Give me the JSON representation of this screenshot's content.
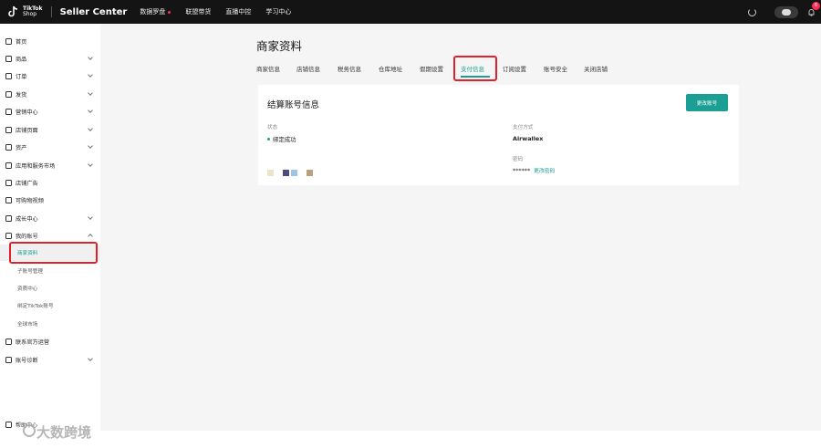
{
  "topbar": {
    "logo_line1": "TikTok",
    "logo_line2": "Shop",
    "seller_center": "Seller Center",
    "nav": [
      "数据罗盘",
      "联盟带货",
      "直播中控",
      "学习中心"
    ],
    "notification_count": "6"
  },
  "sidebar": {
    "items": [
      {
        "label": "首页",
        "icon": "home-icon"
      },
      {
        "label": "商品",
        "icon": "product-icon"
      },
      {
        "label": "订单",
        "icon": "order-icon"
      },
      {
        "label": "发货",
        "icon": "shipping-icon"
      },
      {
        "label": "营销中心",
        "icon": "marketing-icon"
      },
      {
        "label": "店铺页面",
        "icon": "store-page-icon"
      },
      {
        "label": "资产",
        "icon": "assets-icon"
      },
      {
        "label": "应用和服务市场",
        "icon": "app-market-icon"
      },
      {
        "label": "店铺广告",
        "icon": "ads-icon"
      },
      {
        "label": "可购物视频",
        "icon": "video-icon"
      },
      {
        "label": "成长中心",
        "icon": "growth-icon"
      },
      {
        "label": "我的账号",
        "icon": "account-icon"
      }
    ],
    "sub_items": [
      "商家资料",
      "子账号管理",
      "资质中心",
      "绑定TikTok账号",
      "全球市场"
    ],
    "bottom_items": [
      {
        "label": "联系官方运营",
        "icon": "contact-icon"
      },
      {
        "label": "账号诊断",
        "icon": "diagnosis-icon"
      }
    ],
    "footer_doc": "帮助中心"
  },
  "main": {
    "title": "商家资料",
    "tabs": [
      "商家信息",
      "店铺信息",
      "税务信息",
      "仓库地址",
      "假期设置",
      "支付信息",
      "订阅设置",
      "账号安全",
      "关闭店铺"
    ],
    "active_tab": "支付信息"
  },
  "card": {
    "title": "结算账号信息",
    "change_button": "更改账号",
    "status_label": "状态",
    "status_value": "绑定成功",
    "method_label": "支付方式",
    "method_value": "Airwallex",
    "password_label": "密码",
    "password_value": "******",
    "password_link": "更改密码"
  },
  "watermark": "大数跨境",
  "colors": {
    "accent": "#1b9e94",
    "highlight": "#e0202a",
    "topbar": "#141414",
    "status_dot": "#22a35a",
    "swatches": [
      "#ece4c8",
      "#4c4a7e",
      "#9cc4e4",
      "#b8a27e"
    ]
  }
}
